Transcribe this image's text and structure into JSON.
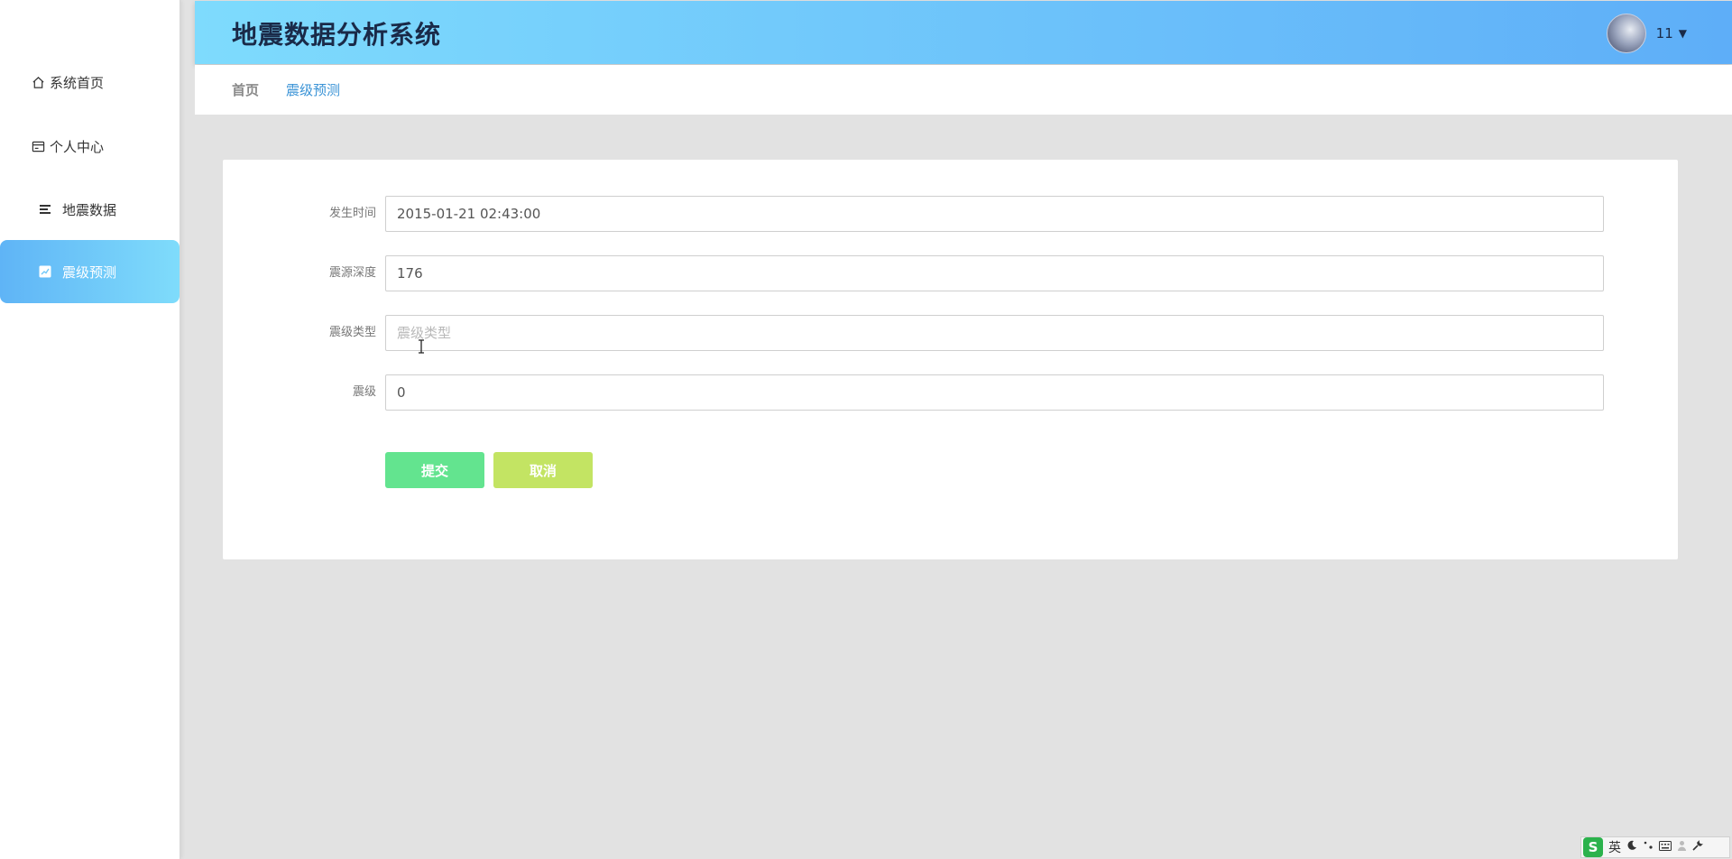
{
  "header": {
    "app_title": "地震数据分析系统",
    "user_name": "11"
  },
  "sidebar": {
    "items": [
      {
        "label": "系统首页",
        "icon": "home-icon",
        "active": false
      },
      {
        "label": "个人中心",
        "icon": "id-card-icon",
        "active": false
      },
      {
        "label": "地震数据",
        "icon": "list-icon",
        "active": false
      },
      {
        "label": "震级预测",
        "icon": "chart-icon",
        "active": true
      }
    ]
  },
  "breadcrumb": {
    "home": "首页",
    "current": "震级预测"
  },
  "form": {
    "fields": [
      {
        "label": "发生时间",
        "value": "2015-01-21 02:43:00",
        "placeholder": ""
      },
      {
        "label": "震源深度",
        "value": "176",
        "placeholder": ""
      },
      {
        "label": "震级类型",
        "value": "",
        "placeholder": "震级类型"
      },
      {
        "label": "震级",
        "value": "0",
        "placeholder": ""
      }
    ],
    "submit_label": "提交",
    "cancel_label": "取消"
  },
  "ime": {
    "logo": "S",
    "mode": "英"
  },
  "colors": {
    "header_gradient_start": "#7edbfd",
    "header_gradient_end": "#5eaef8",
    "active_nav_start": "#5fb4f6",
    "active_nav_end": "#7fdcfb",
    "submit": "#63e48f",
    "cancel": "#c3e463",
    "breadcrumb_active": "#3a93d6"
  }
}
